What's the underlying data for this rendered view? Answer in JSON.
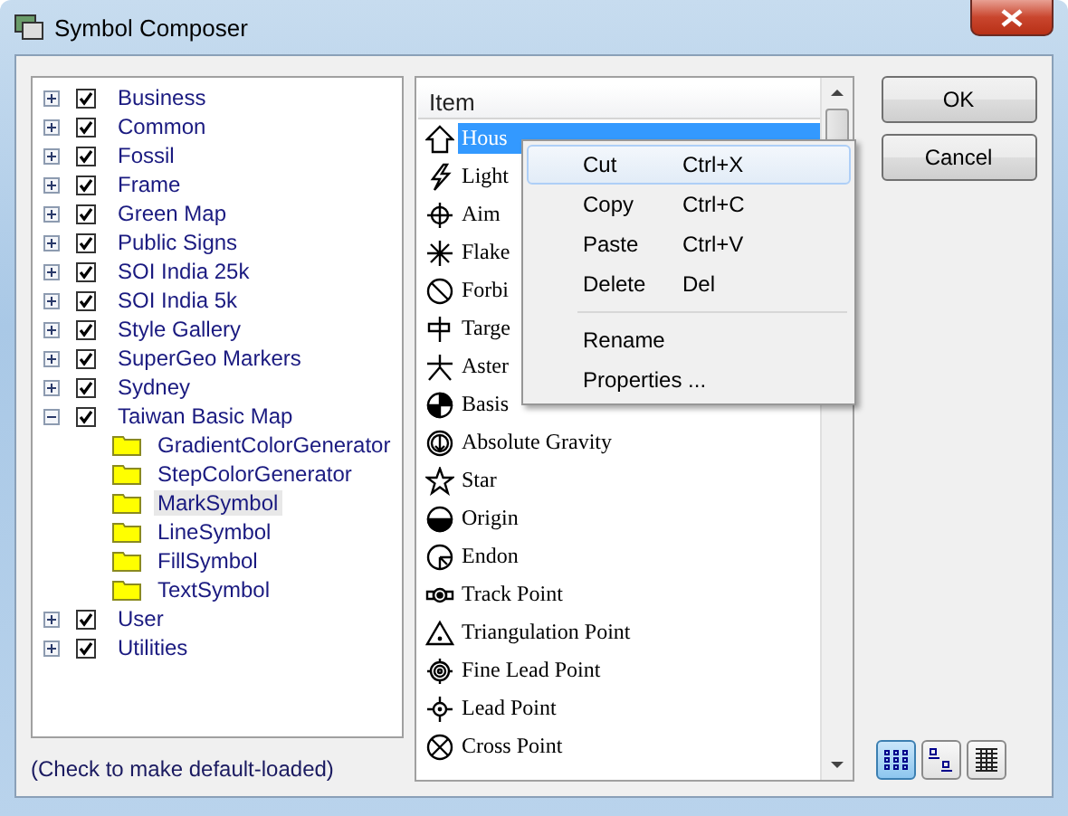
{
  "window": {
    "title": "Symbol Composer"
  },
  "tree": [
    {
      "label": "Business",
      "expanded": false,
      "checked": true
    },
    {
      "label": "Common",
      "expanded": false,
      "checked": true
    },
    {
      "label": "Fossil",
      "expanded": false,
      "checked": true
    },
    {
      "label": "Frame",
      "expanded": false,
      "checked": true
    },
    {
      "label": "Green Map",
      "expanded": false,
      "checked": true
    },
    {
      "label": "Public Signs",
      "expanded": false,
      "checked": true
    },
    {
      "label": "SOI India 25k",
      "expanded": false,
      "checked": true
    },
    {
      "label": "SOI India 5k",
      "expanded": false,
      "checked": true
    },
    {
      "label": "Style Gallery",
      "expanded": false,
      "checked": true
    },
    {
      "label": "SuperGeo Markers",
      "expanded": false,
      "checked": true
    },
    {
      "label": "Sydney",
      "expanded": false,
      "checked": true
    },
    {
      "label": "Taiwan Basic Map",
      "expanded": true,
      "checked": true,
      "children": [
        {
          "label": "GradientColorGenerator",
          "selected": false
        },
        {
          "label": "StepColorGenerator",
          "selected": false
        },
        {
          "label": "MarkSymbol",
          "selected": true
        },
        {
          "label": "LineSymbol",
          "selected": false
        },
        {
          "label": "FillSymbol",
          "selected": false
        },
        {
          "label": "TextSymbol",
          "selected": false
        }
      ]
    },
    {
      "label": "User",
      "expanded": false,
      "checked": true
    },
    {
      "label": "Utilities",
      "expanded": false,
      "checked": true
    }
  ],
  "hint": "(Check to make default-loaded)",
  "list": {
    "column": "Item",
    "items": [
      {
        "label": "Hous",
        "selected": true
      },
      {
        "label": "Light",
        "selected": false
      },
      {
        "label": "Aim",
        "selected": false
      },
      {
        "label": "Flake",
        "selected": false
      },
      {
        "label": "Forbi",
        "selected": false
      },
      {
        "label": "Targe",
        "selected": false
      },
      {
        "label": "Aster",
        "selected": false
      },
      {
        "label": "Basis",
        "selected": false
      },
      {
        "label": "Absolute Gravity",
        "selected": false
      },
      {
        "label": "Star",
        "selected": false
      },
      {
        "label": "Origin",
        "selected": false
      },
      {
        "label": "Endon",
        "selected": false
      },
      {
        "label": "Track Point",
        "selected": false
      },
      {
        "label": "Triangulation Point",
        "selected": false
      },
      {
        "label": "Fine Lead Point",
        "selected": false
      },
      {
        "label": "Lead Point",
        "selected": false
      },
      {
        "label": "Cross Point",
        "selected": false
      }
    ]
  },
  "context_menu": [
    {
      "kind": "item",
      "label": "Cut",
      "shortcut": "Ctrl+X",
      "selected": true
    },
    {
      "kind": "item",
      "label": "Copy",
      "shortcut": "Ctrl+C",
      "selected": false
    },
    {
      "kind": "item",
      "label": "Paste",
      "shortcut": "Ctrl+V",
      "selected": false
    },
    {
      "kind": "item",
      "label": "Delete",
      "shortcut": "Del",
      "selected": false
    },
    {
      "kind": "separator"
    },
    {
      "kind": "item",
      "label": "Rename",
      "selected": false
    },
    {
      "kind": "item",
      "label": "Properties ...",
      "selected": false
    }
  ],
  "buttons": [
    "OK",
    "Cancel"
  ],
  "view_modes": [
    {
      "selected": true
    },
    {
      "selected": false
    },
    {
      "selected": false
    }
  ]
}
